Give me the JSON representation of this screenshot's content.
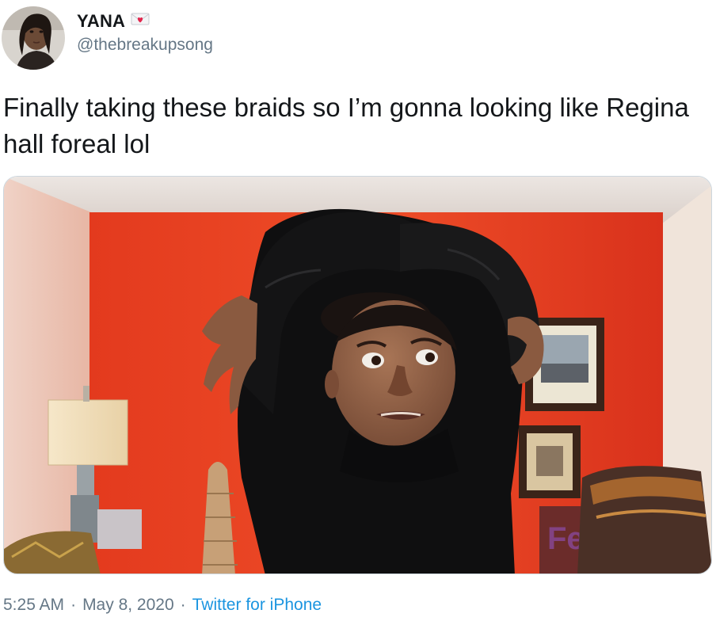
{
  "user": {
    "display_name": "YANA",
    "handle": "@thebreakupsong",
    "name_emoji_icon": "love-letter-icon"
  },
  "tweet": {
    "text": "Finally taking these braids so I’m gonna looking like Regina hall foreal lol"
  },
  "meta": {
    "time": "5:25 AM",
    "separator": "·",
    "date": "May 8, 2020",
    "source": "Twitter for iPhone"
  },
  "colors": {
    "text": "#14171a",
    "secondary": "#657786",
    "link": "#1b95e0",
    "border": "#ccd6dd",
    "wall_red": "#e8311f"
  }
}
